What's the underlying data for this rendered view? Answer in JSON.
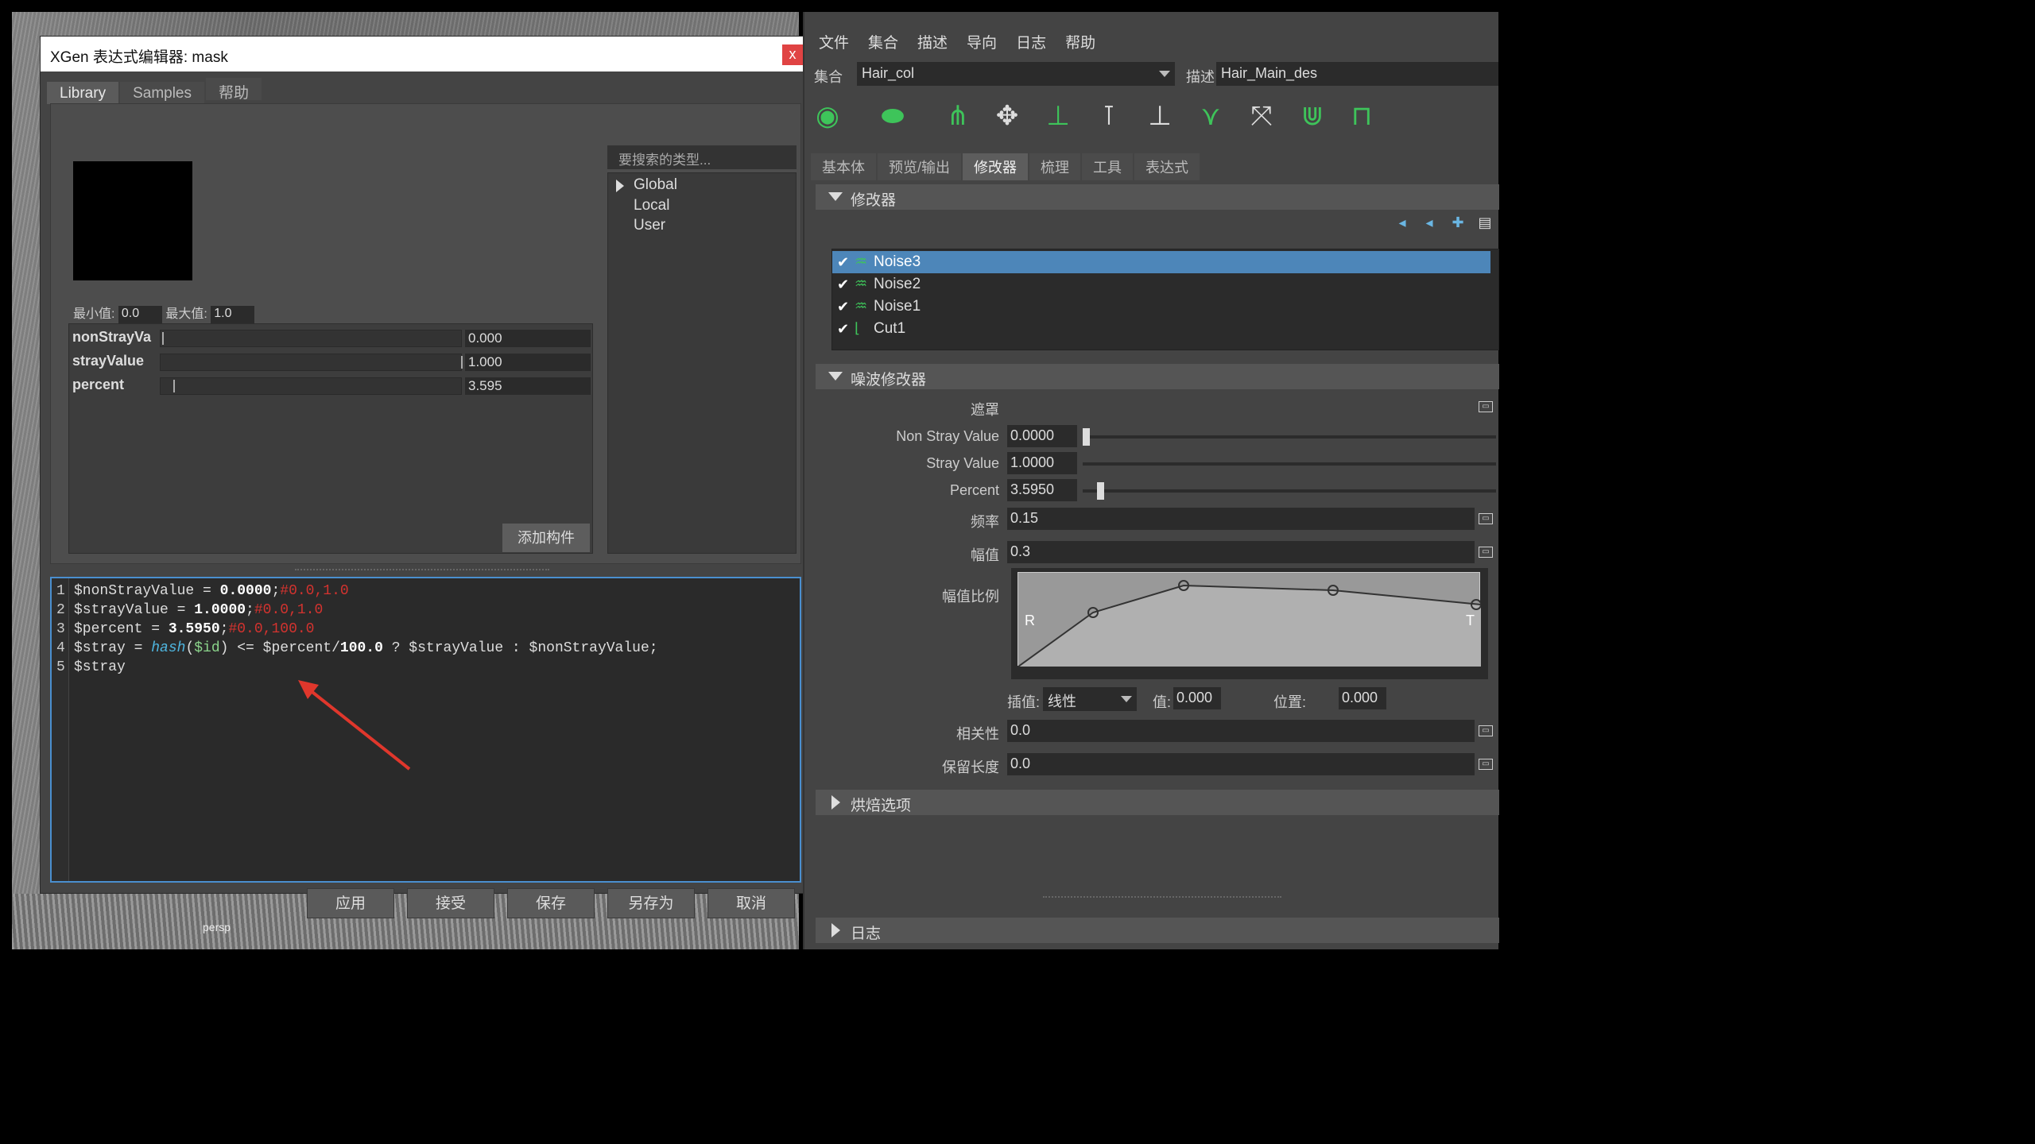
{
  "viewport": {
    "camera_label": "persp"
  },
  "xgen_editor": {
    "title": "XGen 表达式编辑器: mask",
    "close_label": "x",
    "tabs": [
      {
        "label": "Library",
        "active": true
      },
      {
        "label": "Samples",
        "active": false
      },
      {
        "label": "帮助",
        "active": false
      }
    ],
    "min_label": "最小值:",
    "min_value": "0.0",
    "max_label": "最大值:",
    "max_value": "1.0",
    "params": [
      {
        "name": "nonStrayVa",
        "value": "0.000",
        "fraction": 0.0
      },
      {
        "name": "strayValue",
        "value": "1.000",
        "fraction": 1.0
      },
      {
        "name": "percent",
        "value": "3.595",
        "fraction": 0.036
      }
    ],
    "add_component_label": "添加构件",
    "search_placeholder": "要搜索的类型...",
    "tree": [
      "Global",
      "Local",
      "User"
    ],
    "code_lines": [
      {
        "num": "1",
        "var": "$nonStrayValue = ",
        "val": "0.0000",
        "semi": ";",
        "cmt": "#0.0,1.0"
      },
      {
        "num": "2",
        "var": "$strayValue = ",
        "val": "1.0000",
        "semi": ";",
        "cmt": "#0.0,1.0"
      },
      {
        "num": "3",
        "var": "$percent = ",
        "val": "3.5950",
        "semi": ";",
        "cmt": "#0.0,100.0"
      },
      {
        "num": "4",
        "pre": "$stray = ",
        "fn": "hash",
        "open": "(",
        "id": "$id",
        "post": ") <= $percent/",
        "num100": "100.0",
        "rest": " ? $strayValue : $nonStrayValue;"
      },
      {
        "num": "5",
        "text": "$stray"
      }
    ],
    "buttons": [
      "应用",
      "接受",
      "保存",
      "另存为",
      "取消"
    ]
  },
  "xgen_panel": {
    "menu": [
      "文件",
      "集合",
      "描述",
      "导向",
      "日志",
      "帮助"
    ],
    "collection_label": "集合",
    "collection_value": "Hair_col",
    "description_label": "描述",
    "description_value": "Hair_Main_des",
    "tabs": [
      {
        "label": "基本体",
        "active": false
      },
      {
        "label": "预览/输出",
        "active": false
      },
      {
        "label": "修改器",
        "active": true
      },
      {
        "label": "梳理",
        "active": false
      },
      {
        "label": "工具",
        "active": false
      },
      {
        "label": "表达式",
        "active": false
      }
    ],
    "modifier_section": "修改器",
    "modifiers": [
      {
        "name": "Noise3",
        "checked": true,
        "selected": true
      },
      {
        "name": "Noise2",
        "checked": true,
        "selected": false
      },
      {
        "name": "Noise1",
        "checked": true,
        "selected": false
      },
      {
        "name": "Cut1",
        "checked": true,
        "selected": false
      }
    ],
    "noise_section": "噪波修改器",
    "mask_label": "遮罩",
    "non_stray_label": "Non Stray Value",
    "non_stray_value": "0.0000",
    "non_stray_fraction": 0.0,
    "stray_label": "Stray Value",
    "stray_value": "1.0000",
    "stray_fraction": 1.0,
    "percent_label": "Percent",
    "percent_value": "3.5950",
    "percent_fraction": 0.036,
    "frequency_label": "频率",
    "frequency_value": "0.15",
    "magnitude_label": "幅值",
    "magnitude_value": "0.3",
    "magnitude_scale_label": "幅值比例",
    "ramp_left_label": "R",
    "ramp_right_label": "T",
    "interp_label": "插值:",
    "interp_value": "线性",
    "value_label": "值:",
    "value_value": "0.000",
    "position_label": "位置:",
    "position_value": "0.000",
    "correlation_label": "相关性",
    "correlation_value": "0.0",
    "preserve_length_label": "保留长度",
    "preserve_length_value": "0.0",
    "bake_section": "烘焙选项",
    "log_section": "日志"
  }
}
